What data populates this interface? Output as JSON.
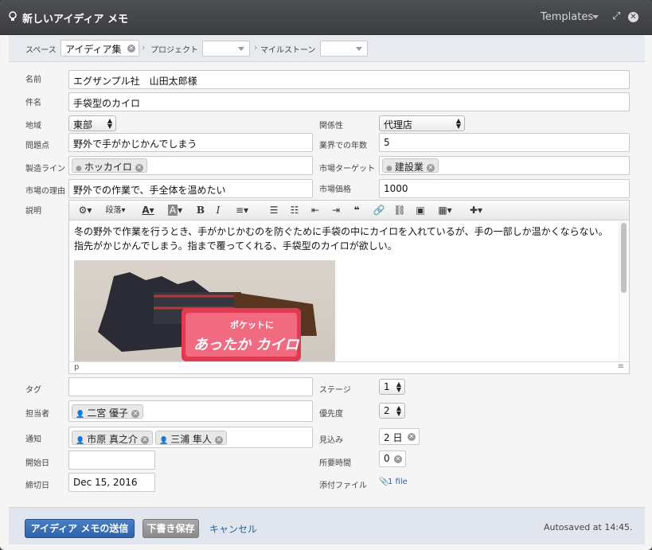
{
  "window": {
    "title": "新しいアイディア メモ",
    "templates_label": "Templates",
    "bulb_icon": "lightbulb-icon",
    "expand_icon": "expand-icon",
    "close_icon": "close-icon"
  },
  "scope": {
    "space_label": "スペース",
    "space_value": "アイディア集",
    "project_label": "プロジェクト",
    "milestone_label": "マイルストーン",
    "separator": "›"
  },
  "form": {
    "name_label": "名前",
    "name_value": "エグザンプル社　山田太郎様",
    "subject_label": "件名",
    "subject_value": "手袋型のカイロ",
    "region_label": "地域",
    "region_value": "東部",
    "relation_label": "関係性",
    "relation_value": "代理店",
    "problem_label": "問題点",
    "problem_value": "野外で手がかじかんでしまう",
    "years_label": "業界での年数",
    "years_value": "5",
    "line_label": "製造ライン",
    "line_value": "ホッカイロ",
    "target_label": "市場ターゲット",
    "target_value": "建設業",
    "reason_label": "市場の理由",
    "reason_value": "野外での作業で、手全体を温めたい",
    "price_label": "市場価格",
    "price_value": "1000",
    "desc_label": "説明",
    "tag_label": "タグ",
    "stage_label": "ステージ",
    "stage_value": "1",
    "assignee_label": "担当者",
    "assignee_value": "二宮 優子",
    "priority_label": "優先度",
    "priority_value": "2",
    "notify_label": "通知",
    "notify_values": [
      "市原 真之介",
      "三浦 隼人"
    ],
    "estimate_label": "見込み",
    "estimate_value": "2 日",
    "start_label": "開始日",
    "duration_label": "所要時間",
    "duration_value": "0",
    "due_label": "締切日",
    "due_value": "Dec 15, 2016",
    "attach_label": "添付ファイル",
    "attach_value": "1 file"
  },
  "editor": {
    "toolbar": {
      "paragraph_label": "段落",
      "bold": "B",
      "italic": "I",
      "quote": "❝"
    },
    "body_lines": [
      "冬の野外で作業を行うとき、手がかじかむのを防ぐために手袋の中にカイロを入れているが、手の一部しか温かくならない。",
      "指先がかじかんでしまう。指まで覆ってくれる、手袋型のカイロが欲しい。"
    ],
    "photo_text": [
      "ポケットに",
      "あったか カイロ"
    ],
    "status_path": "p"
  },
  "footer": {
    "send_label": "アイディア メモの送信",
    "draft_label": "下書き保存",
    "cancel_label": "キャンセル",
    "autosave_text": "Autosaved at 14:45."
  },
  "colors": {
    "primary": "#3b6db0",
    "draft": "#9a9a9a",
    "link": "#2d5f9e",
    "titlebar": "#45474a"
  }
}
